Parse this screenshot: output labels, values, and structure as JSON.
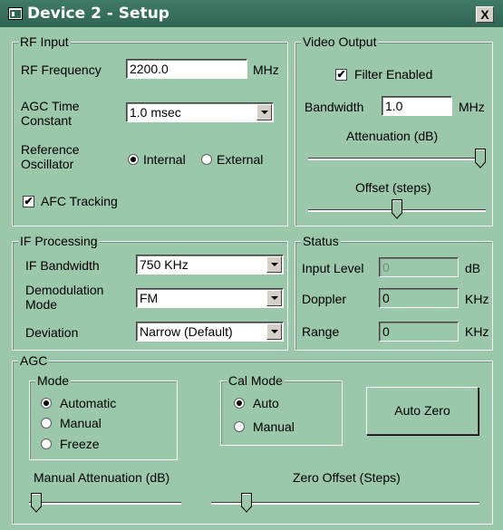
{
  "window": {
    "title": "Device 2 - Setup",
    "close_label": "X"
  },
  "rf_input": {
    "legend": "RF Input",
    "rf_frequency": {
      "label": "RF Frequency",
      "value": "2200.0",
      "unit": "MHz"
    },
    "agc_time_constant": {
      "label": "AGC Time Constant",
      "value": "1.0 msec"
    },
    "reference_oscillator": {
      "label": "Reference Oscillator",
      "options": [
        "Internal",
        "External"
      ],
      "selected": "Internal"
    },
    "afc_tracking": {
      "label": "AFC Tracking",
      "checked": true
    }
  },
  "video_output": {
    "legend": "Video Output",
    "filter_enabled": {
      "label": "Filter Enabled",
      "checked": true
    },
    "bandwidth": {
      "label": "Bandwidth",
      "value": "1.0",
      "unit": "MHz"
    },
    "attenuation": {
      "label": "Attenuation (dB)",
      "position": 1.0
    },
    "offset": {
      "label": "Offset (steps)",
      "position": 0.5
    }
  },
  "if_processing": {
    "legend": "IF Processing",
    "if_bandwidth": {
      "label": "IF Bandwidth",
      "value": "750 KHz"
    },
    "demodulation_mode": {
      "label": "Demodulation Mode",
      "value": "FM"
    },
    "deviation": {
      "label": "Deviation",
      "value": "Narrow (Default)"
    }
  },
  "status": {
    "legend": "Status",
    "input_level": {
      "label": "Input Level",
      "value": "0",
      "unit": "dB"
    },
    "doppler": {
      "label": "Doppler",
      "value": "0",
      "unit": "KHz"
    },
    "range": {
      "label": "Range",
      "value": "0",
      "unit": "KHz"
    }
  },
  "agc": {
    "legend": "AGC",
    "mode": {
      "legend": "Mode",
      "options": [
        "Automatic",
        "Manual",
        "Freeze"
      ],
      "selected": "Automatic"
    },
    "cal_mode": {
      "legend": "Cal Mode",
      "options": [
        "Auto",
        "Manual"
      ],
      "selected": "Auto"
    },
    "auto_zero_label": "Auto Zero",
    "manual_attenuation": {
      "label": "Manual Attenuation (dB)",
      "position": 0.0
    },
    "zero_offset": {
      "label": "Zero Offset (Steps)",
      "position": 0.15
    }
  },
  "colors": {
    "dialog_bg": "#9bc7ab",
    "title_bar": "#2f6553"
  }
}
